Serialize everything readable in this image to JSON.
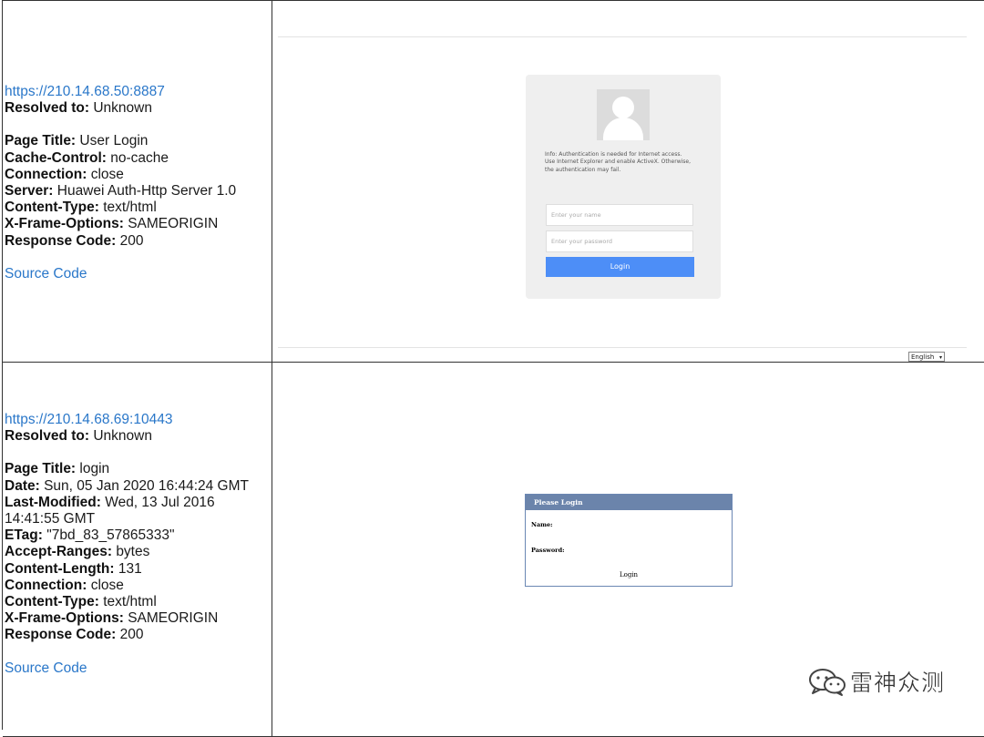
{
  "results": [
    {
      "url": "https://210.14.68.50:8887",
      "resolved_label": "Resolved to:",
      "resolved_value": "Unknown",
      "headers": [
        {
          "key": "Page Title:",
          "value": "User Login"
        },
        {
          "key": "Cache-Control:",
          "value": "no-cache"
        },
        {
          "key": "Connection:",
          "value": "close"
        },
        {
          "key": "Server:",
          "value": "Huawei Auth-Http Server 1.0"
        },
        {
          "key": "Content-Type:",
          "value": "text/html"
        },
        {
          "key": "X-Frame-Options:",
          "value": "SAMEORIGIN"
        },
        {
          "key": "Response Code:",
          "value": "200"
        }
      ],
      "source_link": "Source Code",
      "preview": {
        "info_text": "Info: Authentication is needed for Internet access.\nUse Internet Explorer and enable ActiveX. Otherwise, the authentication may fail.",
        "name_placeholder": "Enter your name",
        "password_placeholder": "Enter your password",
        "login_button": "Login",
        "language": "English"
      }
    },
    {
      "url": "https://210.14.68.69:10443",
      "resolved_label": "Resolved to:",
      "resolved_value": "Unknown",
      "headers": [
        {
          "key": "Page Title:",
          "value": "login"
        },
        {
          "key": "Date:",
          "value": "Sun, 05 Jan 2020 16:44:24 GMT"
        },
        {
          "key": "Last-Modified:",
          "value": "Wed, 13 Jul 2016 14:41:55 GMT"
        },
        {
          "key": "ETag:",
          "value": "\"7bd_83_57865333\""
        },
        {
          "key": "Accept-Ranges:",
          "value": "bytes"
        },
        {
          "key": "Content-Length:",
          "value": "131"
        },
        {
          "key": "Connection:",
          "value": "close"
        },
        {
          "key": "Content-Type:",
          "value": "text/html"
        },
        {
          "key": "X-Frame-Options:",
          "value": "SAMEORIGIN"
        },
        {
          "key": "Response Code:",
          "value": "200"
        }
      ],
      "source_link": "Source Code",
      "preview": {
        "header": "Please Login",
        "name_label": "Name:",
        "password_label": "Password:",
        "login_button": "Login"
      }
    }
  ],
  "watermark": {
    "text": "雷神众测",
    "icon": "wechat-icon"
  }
}
